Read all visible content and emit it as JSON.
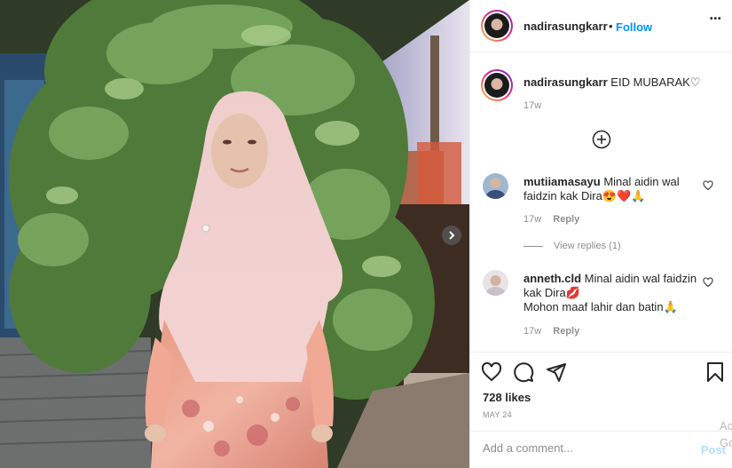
{
  "header": {
    "username": "nadirasungkarr",
    "separator": "•",
    "follow_label": "Follow",
    "more_label": "•••"
  },
  "caption": {
    "username": "nadirasungkarr",
    "text": "EID MUBARAK♡",
    "time": "17w"
  },
  "comments": [
    {
      "username": "mutiiamasayu",
      "text": "Minal aidin wal faidzin kak Dira😍❤️🙏",
      "time": "17w",
      "reply_label": "Reply",
      "view_replies": "View replies (1)"
    },
    {
      "username": "anneth.cld",
      "text": "Minal aidin wal faidzin kak Dira💋",
      "text2": "Mohon maaf lahir dan batin🙏",
      "time": "17w",
      "reply_label": "Reply"
    }
  ],
  "actions": {
    "icons": [
      "heart-icon",
      "comment-icon",
      "share-icon",
      "bookmark-icon"
    ]
  },
  "likes": "728 likes",
  "date": "MAY 24",
  "comment_input": {
    "placeholder": "Add a comment...",
    "value": ""
  },
  "post_button": "Post",
  "watermark": "Ac\nGo",
  "colors": {
    "link_blue": "#0095f6",
    "muted": "#8e8e8e",
    "post_disabled": "#b2dffc"
  }
}
